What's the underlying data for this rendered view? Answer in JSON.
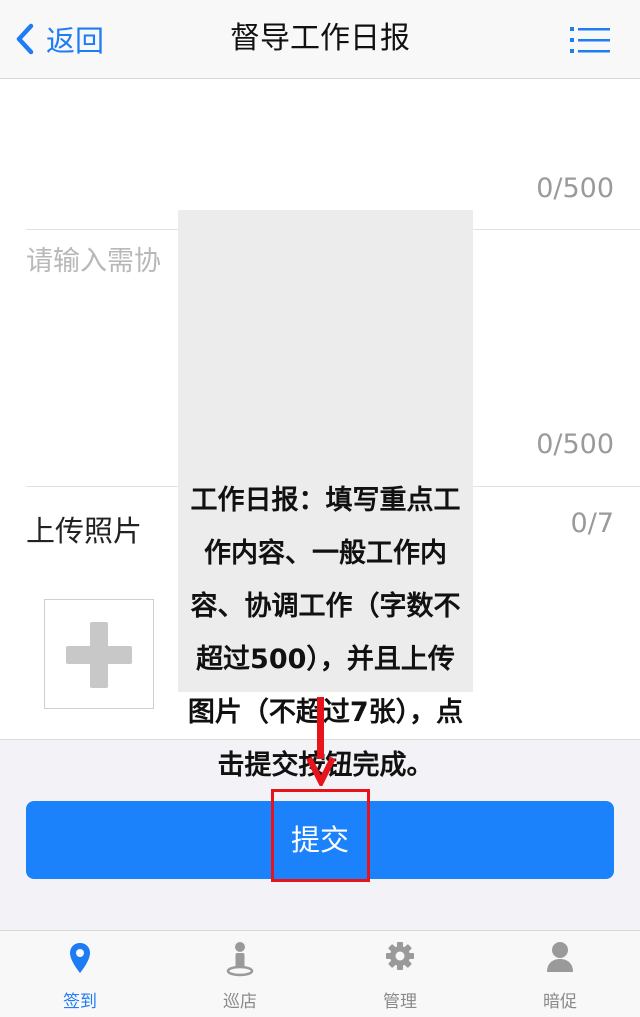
{
  "nav": {
    "back_label": "返回",
    "title": "督导工作日报",
    "menu_icon": "list-menu-icon"
  },
  "form": {
    "field1_counter": "0/500",
    "field2_placeholder": "请输入需协",
    "field2_counter": "0/500",
    "upload_label": "上传照片",
    "upload_counter": "0/7",
    "add_photo_icon": "plus-icon"
  },
  "overlay": {
    "text": "工作日报：填写重点工作内容、一般工作内容、协调工作（字数不超过500），并且上传图片（不超过7张），点击提交按钮完成。"
  },
  "submit_label": "提交",
  "tabs": [
    {
      "label": "签到",
      "icon": "location-pin-icon",
      "active": true
    },
    {
      "label": "巡店",
      "icon": "person-on-spot-icon",
      "active": false
    },
    {
      "label": "管理",
      "icon": "gear-icon",
      "active": false
    },
    {
      "label": "暗促",
      "icon": "user-icon",
      "active": false
    }
  ],
  "colors": {
    "accent": "#1e7cf5",
    "submit": "#1c82fb",
    "annotation_red": "#e8141c",
    "overlay_bg": "#ececec"
  }
}
